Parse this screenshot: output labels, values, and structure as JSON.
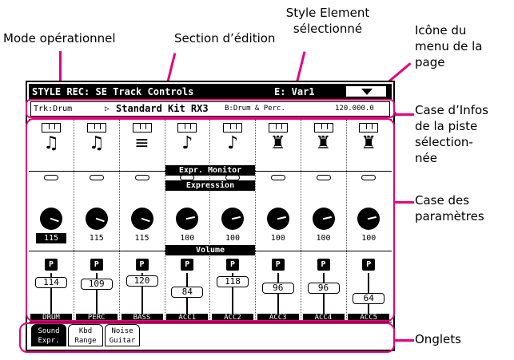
{
  "callouts": {
    "mode": "Mode opérationnel",
    "edit_section": "Section d’édition",
    "style_element": "Style Element\nsélectionné",
    "page_menu": "Icône du\nmenu de la\npage",
    "track_info": "Case d’Infos\nde la piste\nsélection-\nnée",
    "params": "Case des\nparamètres",
    "tabs": "Onglets"
  },
  "screen": {
    "title": "STYLE REC: SE Track Controls",
    "element": "E: Var1",
    "info": {
      "track": "Trk:Drum",
      "arrow": "▷",
      "sound": "Standard Kit RX3",
      "bank": "B:Drum & Perc.",
      "program": "120.000.0"
    },
    "sections": {
      "monitor": "Expr. Monitor",
      "expression": "Expression",
      "volume": "Volume"
    },
    "channels": [
      {
        "label": "DRUM",
        "expression": "115",
        "volume": "114",
        "glyph": "drum-kit-icon",
        "char": "♫",
        "p": "P",
        "vol_level": 114
      },
      {
        "label": "PERC",
        "expression": "115",
        "volume": "109",
        "glyph": "drum-kit-icon",
        "char": "♫",
        "p": "P",
        "vol_level": 109
      },
      {
        "label": "BASS",
        "expression": "115",
        "volume": "120",
        "glyph": "bass-keyboard-icon",
        "char": "≡",
        "p": "P",
        "vol_level": 120
      },
      {
        "label": "ACC1",
        "expression": "100",
        "volume": "84",
        "glyph": "guitar-icon",
        "char": "♪",
        "p": "P",
        "vol_level": 84
      },
      {
        "label": "ACC2",
        "expression": "100",
        "volume": "118",
        "glyph": "guitar-icon",
        "char": "♪",
        "p": "P",
        "vol_level": 118
      },
      {
        "label": "ACC3",
        "expression": "100",
        "volume": "96",
        "glyph": "piano-icon",
        "char": "♜",
        "p": "P",
        "vol_level": 96
      },
      {
        "label": "ACC4",
        "expression": "100",
        "volume": "96",
        "glyph": "piano-icon",
        "char": "♜",
        "p": "P",
        "vol_level": 96
      },
      {
        "label": "ACC5",
        "expression": "100",
        "volume": "64",
        "glyph": "piano-icon",
        "char": "♜",
        "p": "P",
        "vol_level": 64
      }
    ],
    "tabs": [
      {
        "label": "Sound\nExpr.",
        "active": true
      },
      {
        "label": "Kbd\nRange",
        "active": false
      },
      {
        "label": "Noise\nGuitar",
        "active": false
      }
    ]
  },
  "colors": {
    "callout": "#e6007e"
  }
}
